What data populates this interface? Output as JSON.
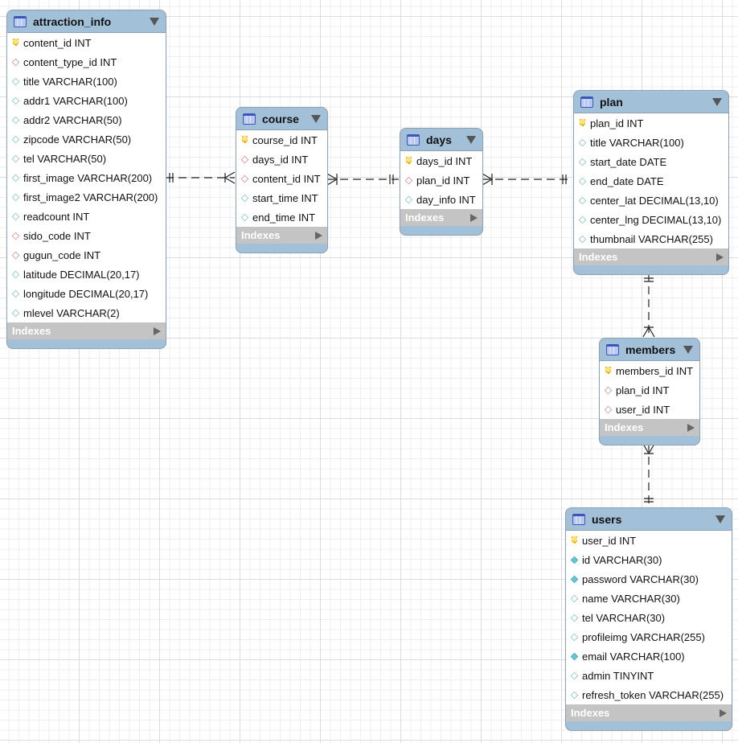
{
  "indexes_label": "Indexes",
  "colors": {
    "header": "#a3c0d9",
    "indexes_bar": "#c4c4c4",
    "fk": "#c98a8a",
    "column": "#7cc0c9",
    "key": "#e6b400"
  },
  "tables": [
    {
      "id": "attraction_info",
      "name": "attraction_info",
      "fields": [
        {
          "label": "content_id INT",
          "icon": "key"
        },
        {
          "label": "content_type_id INT",
          "icon": "fk"
        },
        {
          "label": "title VARCHAR(100)",
          "icon": "plain"
        },
        {
          "label": "addr1 VARCHAR(100)",
          "icon": "plain"
        },
        {
          "label": "addr2 VARCHAR(50)",
          "icon": "plain"
        },
        {
          "label": "zipcode VARCHAR(50)",
          "icon": "plain"
        },
        {
          "label": "tel VARCHAR(50)",
          "icon": "plain"
        },
        {
          "label": "first_image VARCHAR(200)",
          "icon": "plain"
        },
        {
          "label": "first_image2 VARCHAR(200)",
          "icon": "plain"
        },
        {
          "label": "readcount INT",
          "icon": "plain"
        },
        {
          "label": "sido_code INT",
          "icon": "fk"
        },
        {
          "label": "gugun_code INT",
          "icon": "fk"
        },
        {
          "label": "latitude DECIMAL(20,17)",
          "icon": "plain"
        },
        {
          "label": "longitude DECIMAL(20,17)",
          "icon": "plain"
        },
        {
          "label": "mlevel VARCHAR(2)",
          "icon": "plain"
        }
      ]
    },
    {
      "id": "course",
      "name": "course",
      "fields": [
        {
          "label": "course_id INT",
          "icon": "key"
        },
        {
          "label": "days_id INT",
          "icon": "fk"
        },
        {
          "label": "content_id INT",
          "icon": "fk"
        },
        {
          "label": "start_time INT",
          "icon": "plain"
        },
        {
          "label": "end_time INT",
          "icon": "plain"
        }
      ]
    },
    {
      "id": "days",
      "name": "days",
      "fields": [
        {
          "label": "days_id INT",
          "icon": "key"
        },
        {
          "label": "plan_id INT",
          "icon": "fk"
        },
        {
          "label": "day_info INT",
          "icon": "plain"
        }
      ]
    },
    {
      "id": "plan",
      "name": "plan",
      "fields": [
        {
          "label": "plan_id INT",
          "icon": "key"
        },
        {
          "label": "title VARCHAR(100)",
          "icon": "plain"
        },
        {
          "label": "start_date DATE",
          "icon": "plain"
        },
        {
          "label": "end_date DATE",
          "icon": "plain"
        },
        {
          "label": "center_lat DECIMAL(13,10)",
          "icon": "plain"
        },
        {
          "label": "center_lng DECIMAL(13,10)",
          "icon": "plain"
        },
        {
          "label": "thumbnail VARCHAR(255)",
          "icon": "plain"
        }
      ]
    },
    {
      "id": "members",
      "name": "members",
      "fields": [
        {
          "label": "members_id INT",
          "icon": "key"
        },
        {
          "label": "plan_id INT",
          "icon": "fk"
        },
        {
          "label": "user_id INT",
          "icon": "fk"
        }
      ]
    },
    {
      "id": "users",
      "name": "users",
      "fields": [
        {
          "label": "user_id INT",
          "icon": "key"
        },
        {
          "label": "id VARCHAR(30)",
          "icon": "filled"
        },
        {
          "label": "password VARCHAR(30)",
          "icon": "filled"
        },
        {
          "label": "name VARCHAR(30)",
          "icon": "plain"
        },
        {
          "label": "tel VARCHAR(30)",
          "icon": "plain"
        },
        {
          "label": "profileimg VARCHAR(255)",
          "icon": "plain"
        },
        {
          "label": "email VARCHAR(100)",
          "icon": "filled"
        },
        {
          "label": "admin TINYINT",
          "icon": "plain"
        },
        {
          "label": "refresh_token VARCHAR(255)",
          "icon": "plain"
        }
      ]
    }
  ],
  "relationships": [
    {
      "from": "attraction_info",
      "to": "course",
      "type": "one-to-many"
    },
    {
      "from": "days",
      "to": "course",
      "type": "one-to-many"
    },
    {
      "from": "plan",
      "to": "days",
      "type": "one-to-many"
    },
    {
      "from": "plan",
      "to": "members",
      "type": "one-to-many"
    },
    {
      "from": "users",
      "to": "members",
      "type": "one-to-many"
    }
  ]
}
